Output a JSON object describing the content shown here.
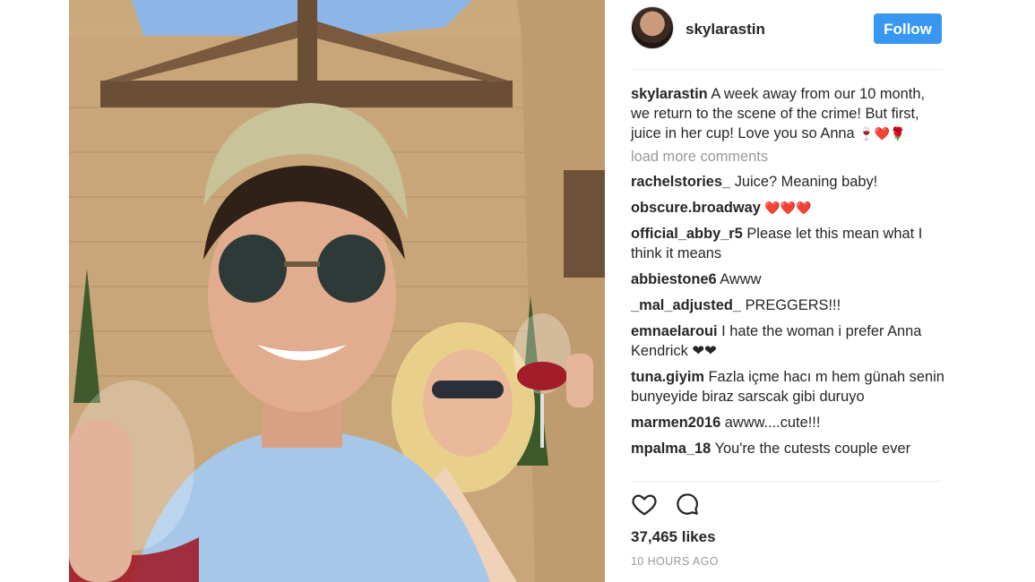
{
  "post": {
    "username": "skylarastin",
    "follow_label": "Follow",
    "caption": "A week away from our 10 month, we return to the scene of the crime! But first, juice in her cup! Love you so Anna",
    "caption_emoji": "🍷❤️🌹",
    "load_more": "load more comments",
    "likes": "37,465 likes",
    "time": "10 HOURS AGO"
  },
  "comments": [
    {
      "user": "rachelstories_",
      "text": "Juice? Meaning baby!"
    },
    {
      "user": "obscure.broadway",
      "text": "❤️❤️❤️"
    },
    {
      "user": "official_abby_r5",
      "text": "Please let this mean what I think it means"
    },
    {
      "user": "abbiestone6",
      "text": "Awww"
    },
    {
      "user": "_mal_adjusted_",
      "text": "PREGGERS!!!"
    },
    {
      "user": "emnaelaroui",
      "text": "I hate the woman i prefer Anna Kendrick ❤❤"
    },
    {
      "user": "tuna.giyim",
      "text": "Fazla içme hacı m hem günah senin bunyeyide biraz sarscak gibi duruyo"
    },
    {
      "user": "marmen2016",
      "text": "awww....cute!!!"
    },
    {
      "user": "mpalma_18",
      "text": "You're the cutests couple ever"
    }
  ],
  "icons": {
    "like": "heart-icon",
    "comment": "comment-bubble-icon"
  },
  "colors": {
    "follow_bg": "#3897f0",
    "muted": "#999999",
    "text": "#262626"
  }
}
